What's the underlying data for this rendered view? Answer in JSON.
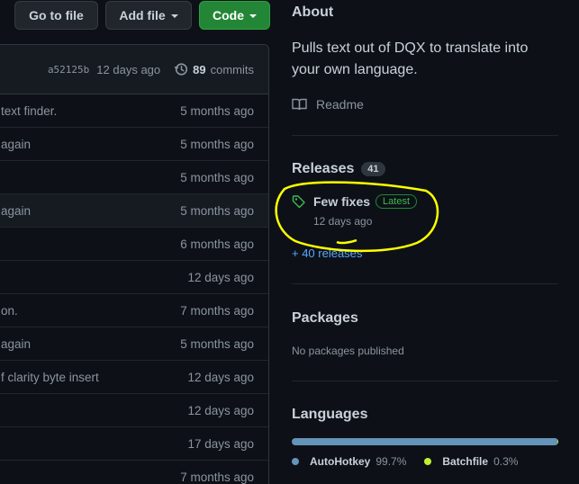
{
  "toolbar": {
    "go_to_file": "Go to file",
    "add_file": "Add file",
    "code": "Code"
  },
  "commit_header": {
    "sha": "a52125b",
    "age": "12 days ago",
    "commit_count": "89",
    "commits_label": "commits"
  },
  "rows": [
    {
      "msg": "text finder.",
      "age": "5 months ago"
    },
    {
      "msg": "again",
      "age": "5 months ago"
    },
    {
      "msg": "",
      "age": "5 months ago"
    },
    {
      "msg": "again",
      "age": "5 months ago"
    },
    {
      "msg": "",
      "age": "6 months ago"
    },
    {
      "msg": "",
      "age": "12 days ago"
    },
    {
      "msg": "on.",
      "age": "7 months ago"
    },
    {
      "msg": "again",
      "age": "5 months ago"
    },
    {
      "msg": "f clarity byte insert",
      "age": "12 days ago"
    },
    {
      "msg": "",
      "age": "12 days ago"
    },
    {
      "msg": "",
      "age": "17 days ago"
    },
    {
      "msg": "",
      "age": "7 months ago"
    }
  ],
  "about": {
    "title": "About",
    "description": "Pulls text out of DQX to translate into your own language.",
    "readme": "Readme"
  },
  "releases": {
    "title": "Releases",
    "count": "41",
    "latest_name": "Few fixes",
    "latest_badge": "Latest",
    "latest_age": "12 days ago",
    "more": "+ 40 releases"
  },
  "packages": {
    "title": "Packages",
    "none": "No packages published"
  },
  "languages": {
    "title": "Languages",
    "items": [
      {
        "name": "AutoHotkey",
        "percent": "99.7%",
        "value": 99.7,
        "color": "#6594b9"
      },
      {
        "name": "Batchfile",
        "percent": "0.3%",
        "value": 0.3,
        "color": "#c1f12e"
      }
    ]
  },
  "annotation": {
    "color": "#ffff00"
  },
  "icons": [
    "history-icon",
    "book-icon",
    "tag-icon"
  ]
}
